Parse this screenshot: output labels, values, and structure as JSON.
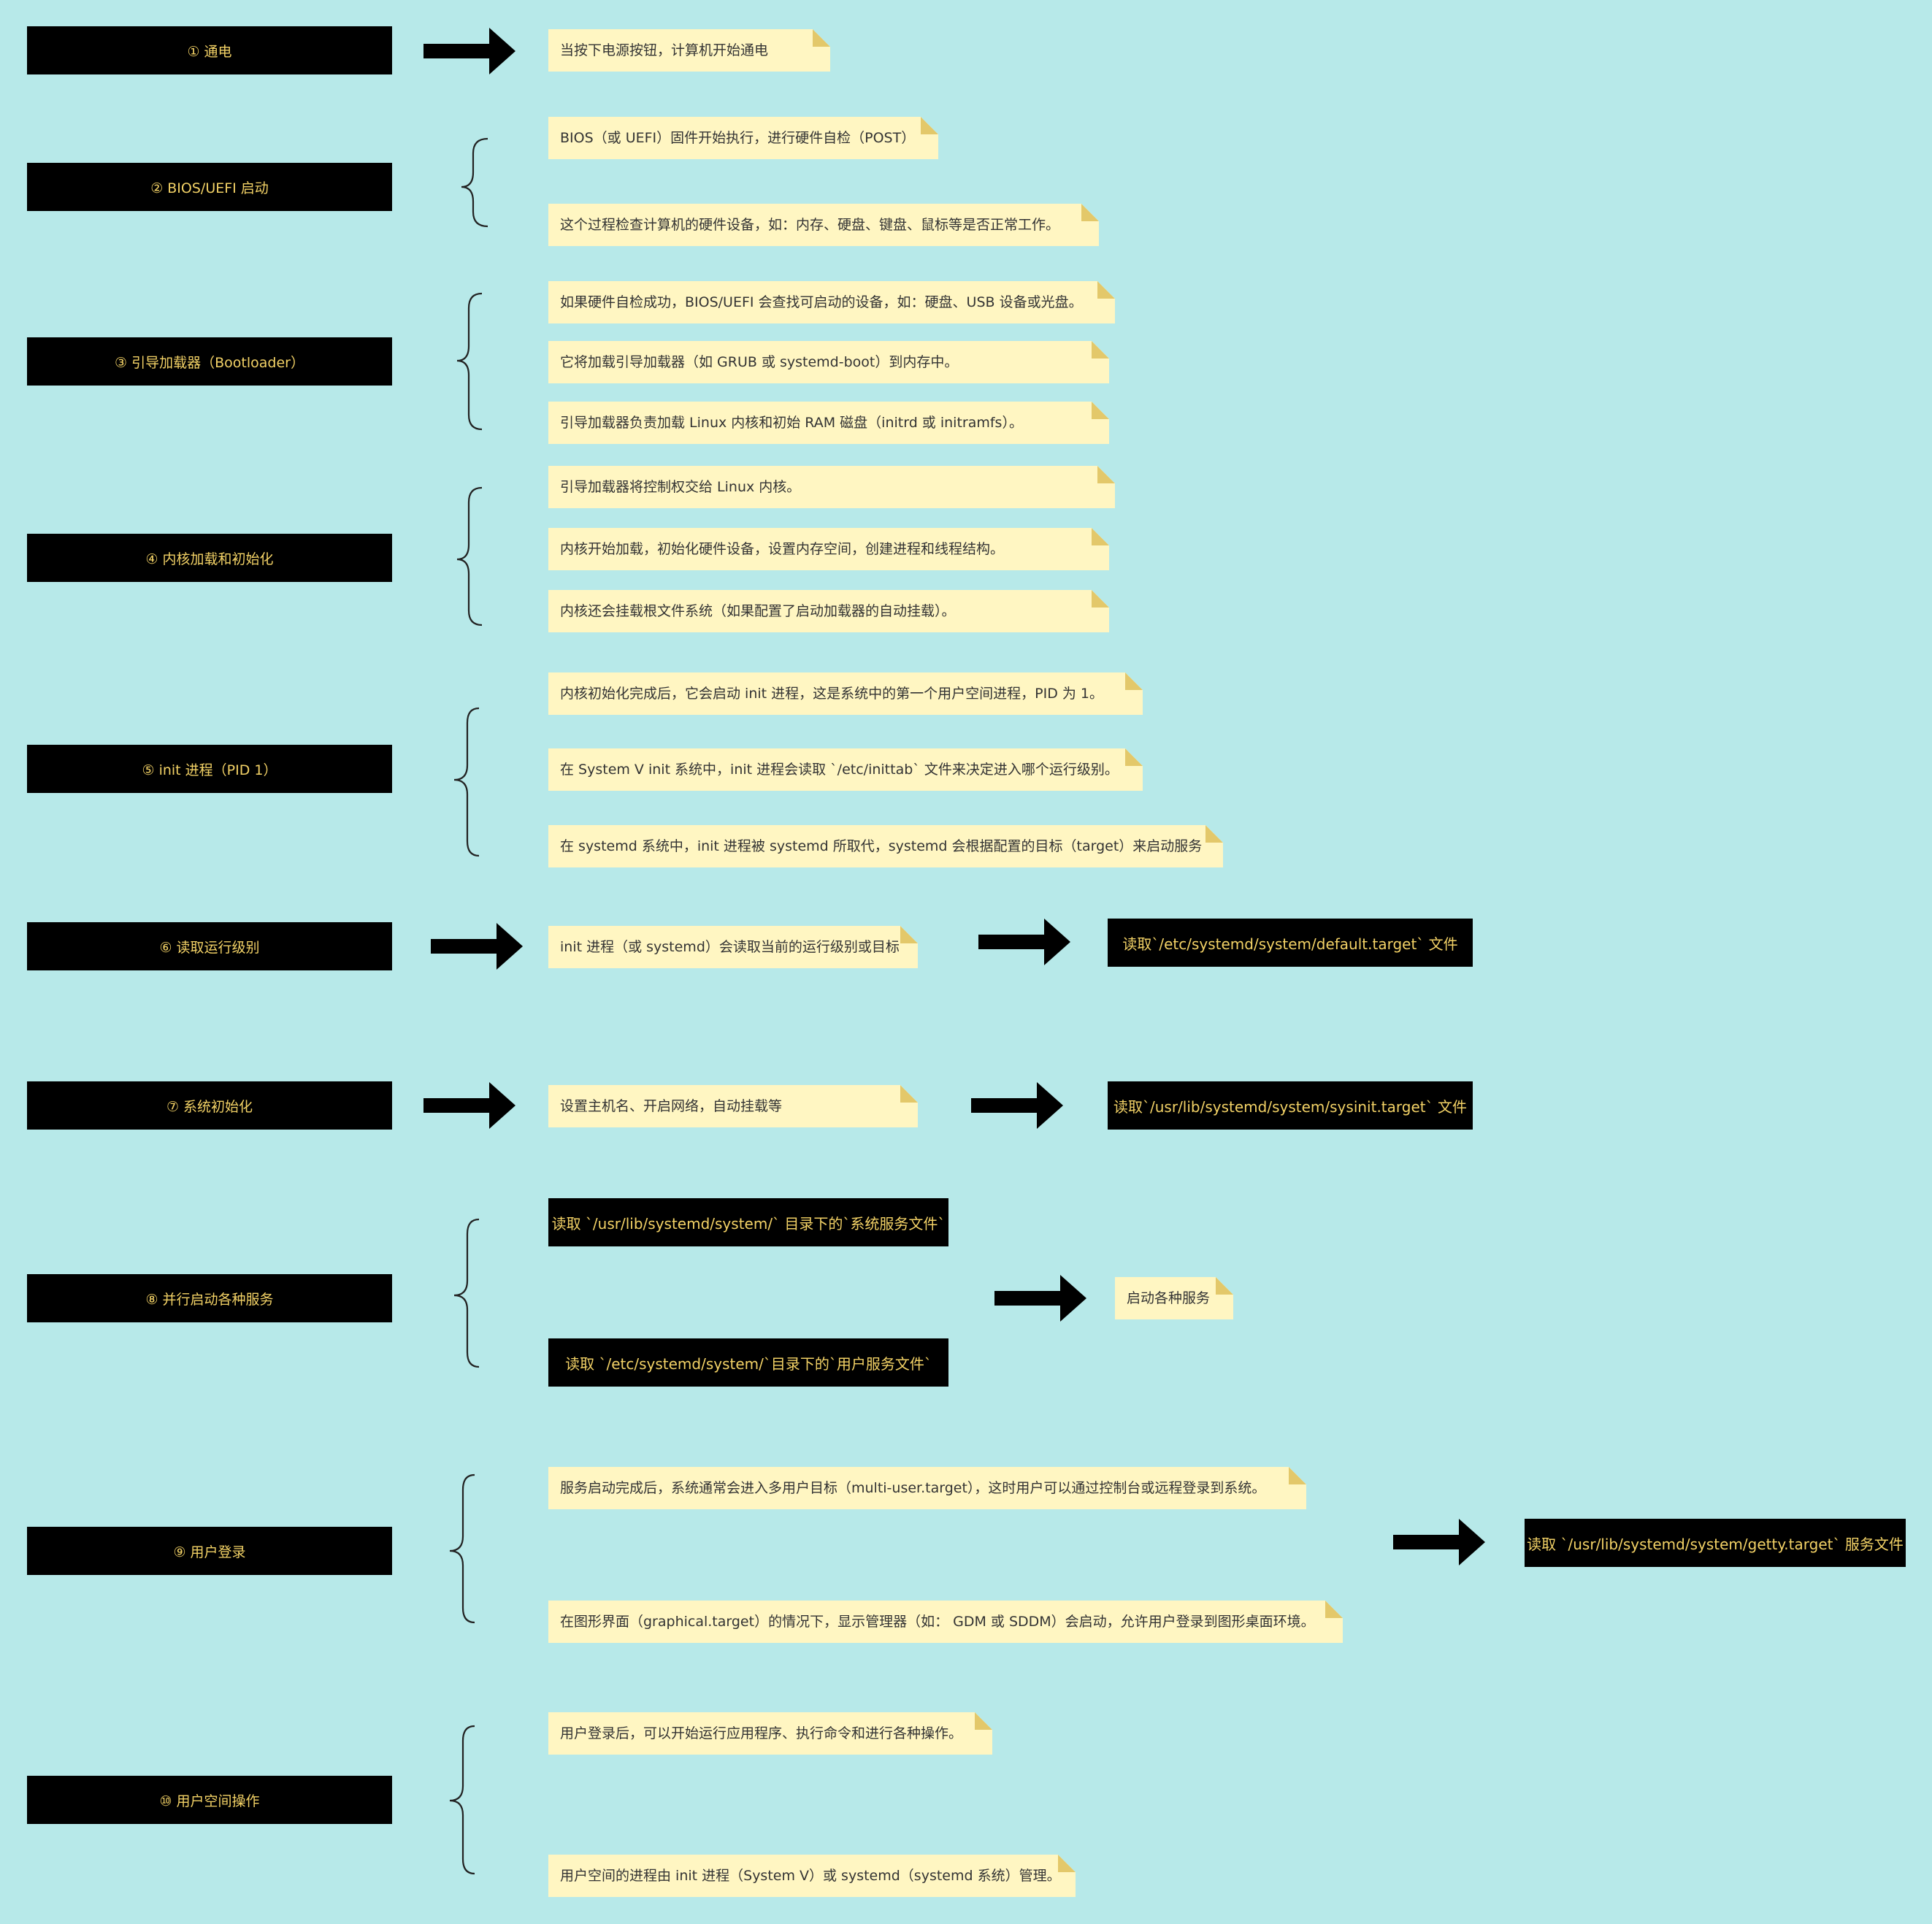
{
  "steps": [
    {
      "label": "① 通电"
    },
    {
      "label": "② BIOS/UEFI 启动"
    },
    {
      "label": "③ 引导加载器（Bootloader）"
    },
    {
      "label": "④ 内核加载和初始化"
    },
    {
      "label": "⑤ init 进程（PID 1）"
    },
    {
      "label": "⑥ 读取运行级别"
    },
    {
      "label": "⑦ 系统初始化"
    },
    {
      "label": "⑧ 并行启动各种服务"
    },
    {
      "label": "⑨ 用户登录"
    },
    {
      "label": "⑩ 用户空间操作"
    }
  ],
  "notes": {
    "s1": [
      "当按下电源按钮，计算机开始通电"
    ],
    "s2": [
      "BIOS（或 UEFI）固件开始执行，进行硬件自检（POST）",
      "这个过程检查计算机的硬件设备，如：内存、硬盘、键盘、鼠标等是否正常工作。"
    ],
    "s3": [
      "如果硬件自检成功，BIOS/UEFI 会查找可启动的设备，如：硬盘、USB 设备或光盘。",
      "它将加载引导加载器（如 GRUB 或 systemd-boot）到内存中。",
      "引导加载器负责加载 Linux 内核和初始 RAM 磁盘（initrd 或 initramfs）。"
    ],
    "s4": [
      "引导加载器将控制权交给 Linux 内核。",
      "内核开始加载，初始化硬件设备，设置内存空间，创建进程和线程结构。",
      "内核还会挂载根文件系统（如果配置了启动加载器的自动挂载）。"
    ],
    "s5": [
      "内核初始化完成后，它会启动 init 进程，这是系统中的第一个用户空间进程，PID 为 1。",
      "在 System V init 系统中，init 进程会读取 `/etc/inittab` 文件来决定进入哪个运行级别。",
      "在 systemd 系统中，init 进程被 systemd 所取代，systemd 会根据配置的目标（target）来启动服务"
    ],
    "s6": [
      "init 进程（或 systemd）会读取当前的运行级别或目标"
    ],
    "s7": [
      "设置主机名、开启网络，自动挂载等"
    ],
    "s8": [
      "启动各种服务"
    ],
    "s9": [
      "服务启动完成后，系统通常会进入多用户目标（multi-user.target），这时用户可以通过控制台或远程登录到系统。",
      "在图形界面（graphical.target）的情况下，显示管理器（如： GDM 或 SDDM）会启动，允许用户登录到图形桌面环境。"
    ],
    "s10": [
      "用户登录后，可以开始运行应用程序、执行命令和进行各种操作。",
      "用户空间的进程由 init 进程（System V）或 systemd（systemd 系统）管理。"
    ]
  },
  "dark_boxes": {
    "s6": "读取`/etc/systemd/system/default.target` 文件",
    "s7": "读取`/usr/lib/systemd/system/sysinit.target` 文件",
    "s8a": "读取 `/usr/lib/systemd/system/` 目录下的`系统服务文件`",
    "s8b": "读取 `/etc/systemd/system/`目录下的`用户服务文件`",
    "s9": "读取 `/usr/lib/systemd/system/getty.target` 服务文件"
  },
  "colors": {
    "background": "#b7e9e9",
    "step_box": "#000000",
    "step_text": "#f3d266",
    "note_bg": "#fff6c2",
    "note_fold": "#e3c86a",
    "arrow": "#000000",
    "brace": "#222222"
  }
}
